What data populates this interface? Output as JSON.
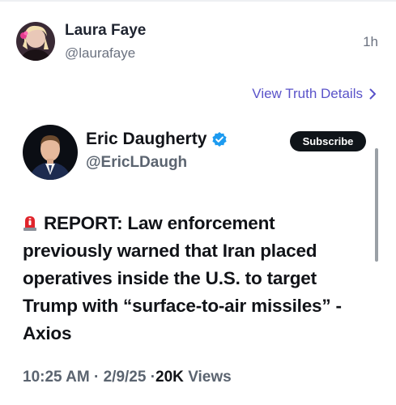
{
  "post": {
    "author_name": "Laura Faye",
    "author_handle": "@laurafaye",
    "time_ago": "1h",
    "view_details_label": "View Truth Details"
  },
  "embed": {
    "name": "Eric Daugherty",
    "handle": "@EricLDaugh",
    "subscribe_label": "Subscribe",
    "verified_color": "#1d9bf0",
    "icon_siren": "siren-emoji",
    "text": "REPORT: Law enforcement previously warned that Iran placed operatives inside the U.S. to target Trump with “surface-to-air missiles” - Axios",
    "time": "10:25 AM",
    "date": "2/9/25",
    "views_count": "20K",
    "views_label": "Views",
    "separator": "·"
  },
  "colors": {
    "accent": "#5a53c9",
    "text": "#111318",
    "muted": "#6b7280"
  }
}
